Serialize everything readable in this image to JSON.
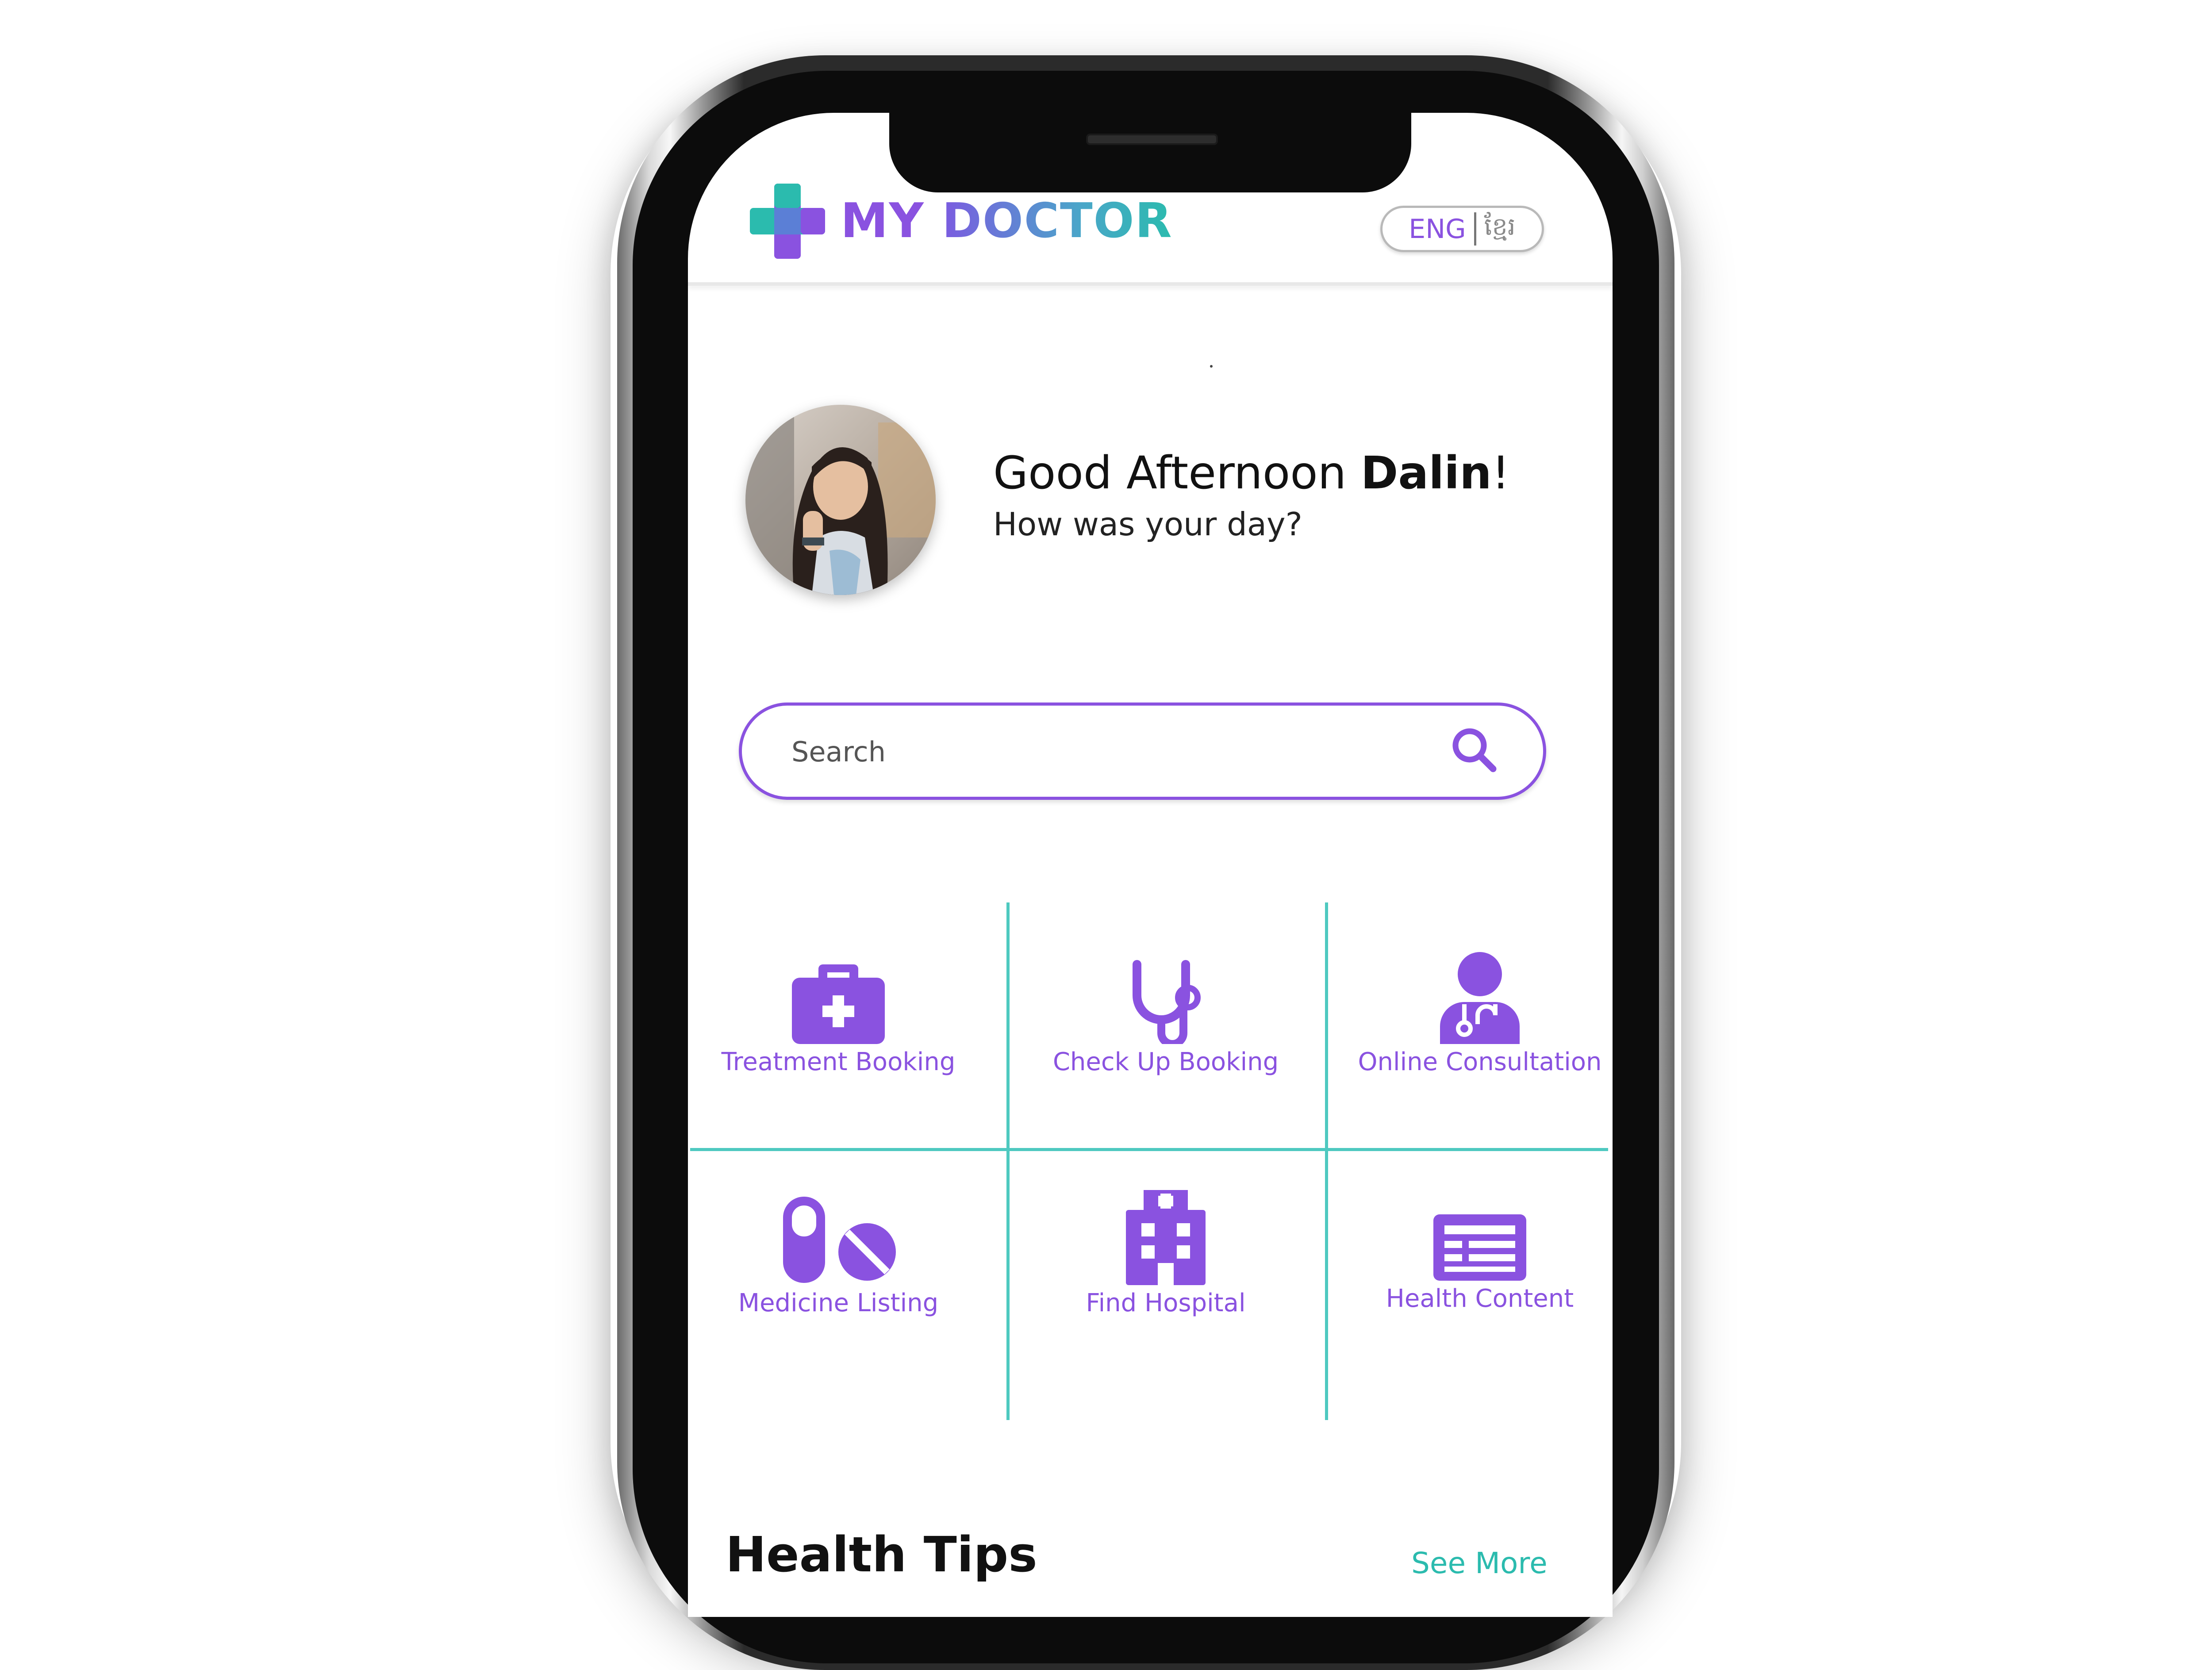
{
  "colors": {
    "accent": "#8a52e0",
    "teal": "#2bbbae",
    "divider": "#4ec9c0"
  },
  "header": {
    "logo_my": "MY",
    "logo_doctor": "DOCTOR",
    "logo_icon": "medical-cross-icon",
    "lang_en": "ENG",
    "lang_km": "ខ្មែរ"
  },
  "greeting": {
    "salutation": "Good Afternoon ",
    "name": "Dalin",
    "punct": "!",
    "subtitle": "How was your day?"
  },
  "search": {
    "placeholder": "Search",
    "icon": "search-icon"
  },
  "services": [
    {
      "label": "Treatment Booking",
      "icon": "medical-kit-icon"
    },
    {
      "label": "Check Up Booking",
      "icon": "stethoscope-icon"
    },
    {
      "label": "Online Consultation",
      "icon": "doctor-icon"
    },
    {
      "label": "Medicine Listing",
      "icon": "pills-icon"
    },
    {
      "label": "Find Hospital",
      "icon": "hospital-icon"
    },
    {
      "label": "Health Content",
      "icon": "news-icon"
    }
  ],
  "health_tips": {
    "title": "Health Tips",
    "see_more": "See More"
  }
}
